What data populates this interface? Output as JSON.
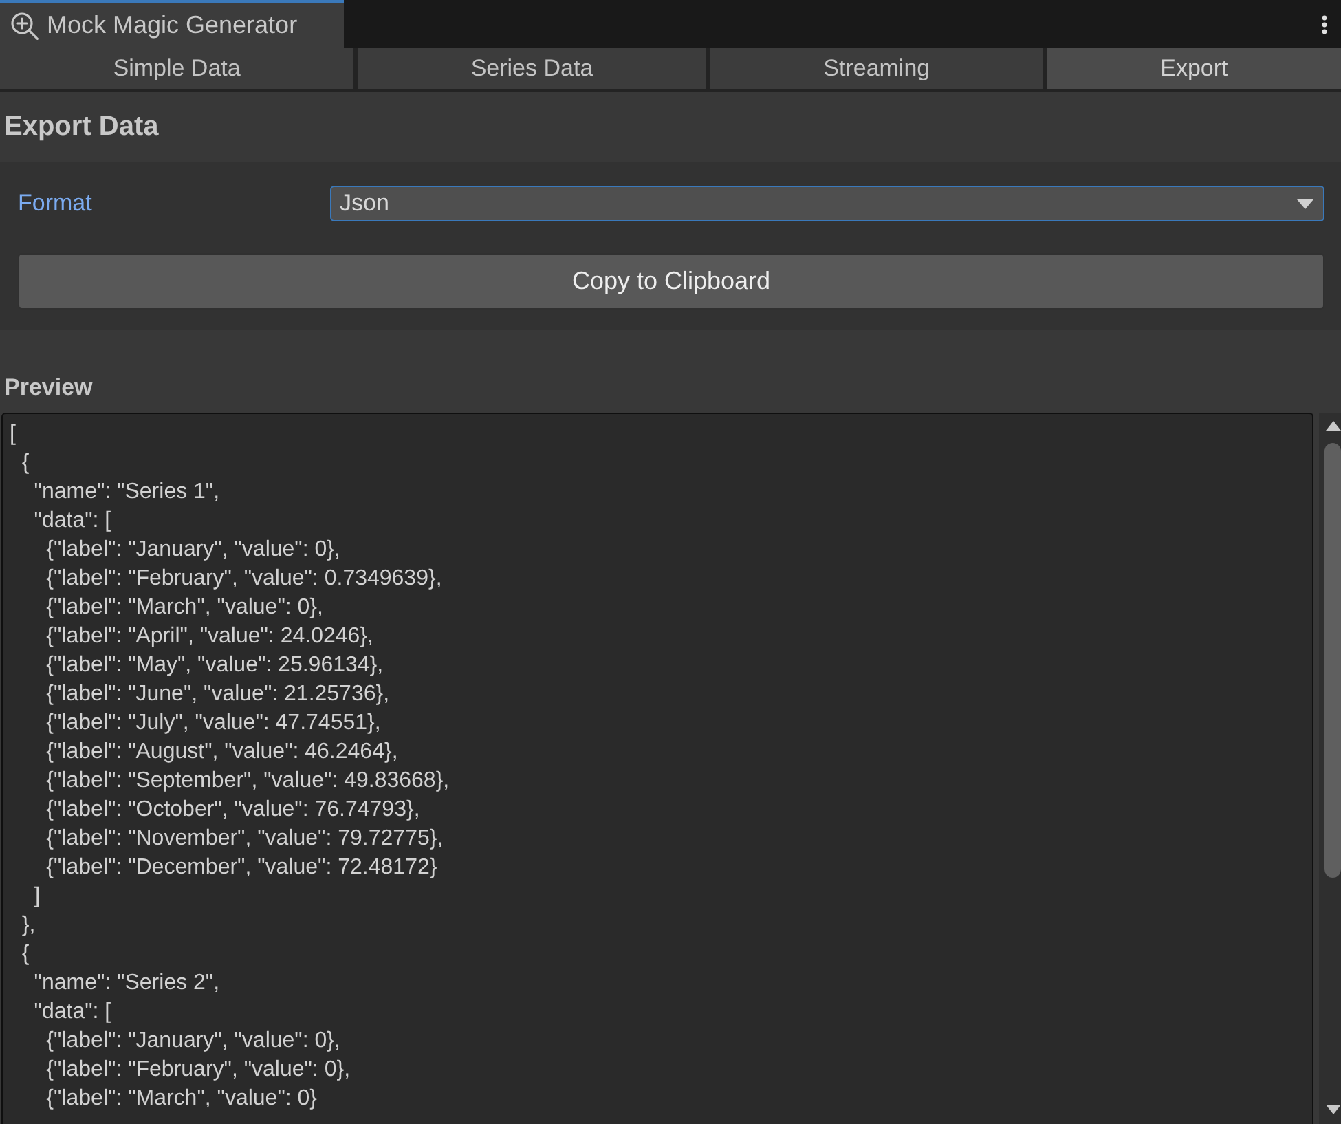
{
  "window": {
    "title": "Mock Magic Generator"
  },
  "tabs": [
    {
      "label": "Simple Data",
      "selected": false
    },
    {
      "label": "Series Data",
      "selected": false
    },
    {
      "label": "Streaming",
      "selected": false
    },
    {
      "label": "Export",
      "selected": true
    }
  ],
  "export_section": {
    "title": "Export Data",
    "format": {
      "label": "Format",
      "value": "Json",
      "focused": true
    },
    "copy_button": "Copy to Clipboard"
  },
  "preview": {
    "title": "Preview",
    "value": "[\n  {\n    \"name\": \"Series 1\",\n    \"data\": [\n      {\"label\": \"January\", \"value\": 0},\n      {\"label\": \"February\", \"value\": 0.7349639},\n      {\"label\": \"March\", \"value\": 0},\n      {\"label\": \"April\", \"value\": 24.0246},\n      {\"label\": \"May\", \"value\": 25.96134},\n      {\"label\": \"June\", \"value\": 21.25736},\n      {\"label\": \"July\", \"value\": 47.74551},\n      {\"label\": \"August\", \"value\": 46.2464},\n      {\"label\": \"September\", \"value\": 49.83668},\n      {\"label\": \"October\", \"value\": 76.74793},\n      {\"label\": \"November\", \"value\": 79.72775},\n      {\"label\": \"December\", \"value\": 72.48172}\n    ]\n  },\n  {\n    \"name\": \"Series 2\",\n    \"data\": [\n      {\"label\": \"January\", \"value\": 0},\n      {\"label\": \"February\", \"value\": 0},\n      {\"label\": \"March\", \"value\": 0}"
  }
}
